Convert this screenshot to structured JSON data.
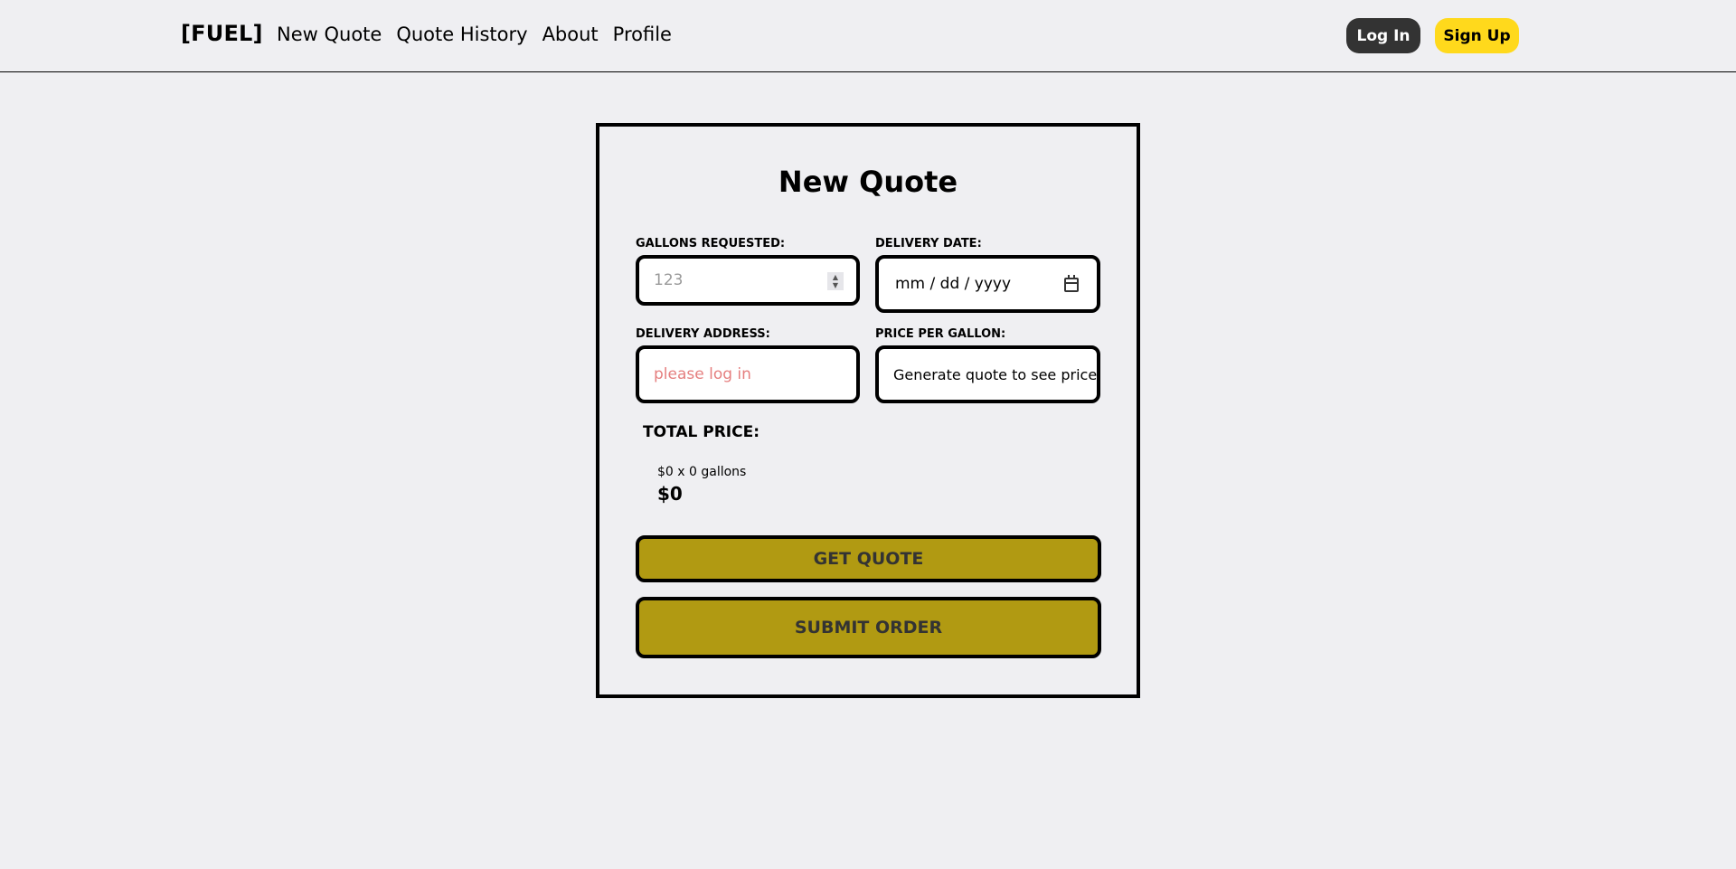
{
  "header": {
    "brand": "[FUEL]",
    "nav": [
      "New Quote",
      "Quote History",
      "About",
      "Profile"
    ],
    "login_label": "Log In",
    "signup_label": "Sign Up"
  },
  "form": {
    "title": "New Quote",
    "gallons": {
      "label": "GALLONS REQUESTED:",
      "placeholder": "123"
    },
    "date": {
      "label": "DELIVERY DATE:",
      "placeholder": "mm / dd / yyyy"
    },
    "address": {
      "label": "DELIVERY ADDRESS:",
      "placeholder": "please log in"
    },
    "price": {
      "label": "PRICE PER GALLON:",
      "value": "Generate quote to see price"
    },
    "total": {
      "label": "TOTAL PRICE:",
      "formula": "$0 x 0 gallons",
      "value": "$0"
    },
    "get_quote_label": "GET QUOTE",
    "submit_label": "SUBMIT ORDER"
  },
  "colors": {
    "background": "#efeff2",
    "login_bg": "#333333",
    "signup_bg": "#ffd91c",
    "action_bg": "#b19a12",
    "address_placeholder": "#e57f7f"
  },
  "icons": {
    "date_picker": "calendar-icon",
    "gallons_stepper": "spinner-arrows-icon"
  }
}
